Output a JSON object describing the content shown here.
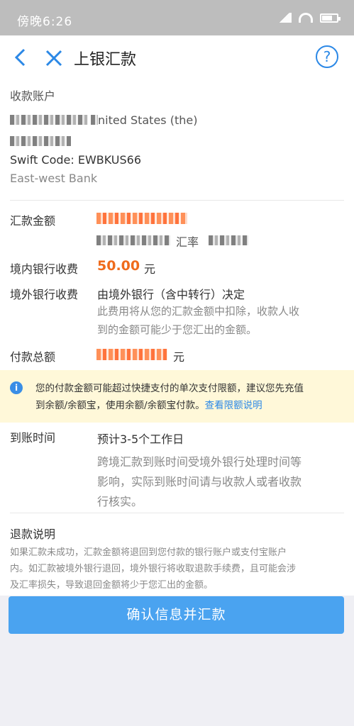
{
  "status_bar": {
    "time": "傍晚6:26"
  },
  "nav": {
    "title": "上银汇款",
    "help": "?"
  },
  "recipient": {
    "section_label": "收款账户",
    "country": "nited States (the)",
    "swift": "Swift Code: EWBKUS66",
    "bank": "East-west Bank"
  },
  "amount": {
    "label": "汇款金额",
    "rate_label": "汇率"
  },
  "domestic_fee": {
    "label": "境内银行收费",
    "value": "50.00",
    "unit": "元"
  },
  "foreign_fee": {
    "label": "境外银行收费",
    "value": "由境外银行（含中转行）决定",
    "note_line1": "此费用将从您的汇款金额中扣除，收款人收",
    "note_line2": "到的金额可能少于您汇出的金额。"
  },
  "total": {
    "label": "付款总额",
    "unit": "元"
  },
  "notice": {
    "line1": "您的付款金额可能超过快捷支付的单次支付限额，建议您先充值",
    "line2": "到余额/余额宝，使用余额/余额宝付款。",
    "link": "查看限额说明"
  },
  "arrival": {
    "label": "到账时间",
    "value": "预计3-5个工作日",
    "note_line1": "跨境汇款到账时间受境外银行处理时间等",
    "note_line2": "影响，实际到账时间请与收款人或者收款",
    "note_line3": "行核实。"
  },
  "refund": {
    "title": "退款说明",
    "line1": "如果汇款未成功，汇款金额将退回到您付款的银行账户或支付宝账户",
    "line2": "内。如汇款被境外银行退回，境外银行将收取退款手续费，且可能会涉",
    "line3": "及汇率损失，导致退回金额将少于您汇出的金额。"
  },
  "confirm_button": "确认信息并汇款",
  "colors": {
    "accent": "#2b88e6",
    "fee": "#ef6b1c",
    "button": "#4aa3f0",
    "notice_bg": "#fff8d9"
  }
}
